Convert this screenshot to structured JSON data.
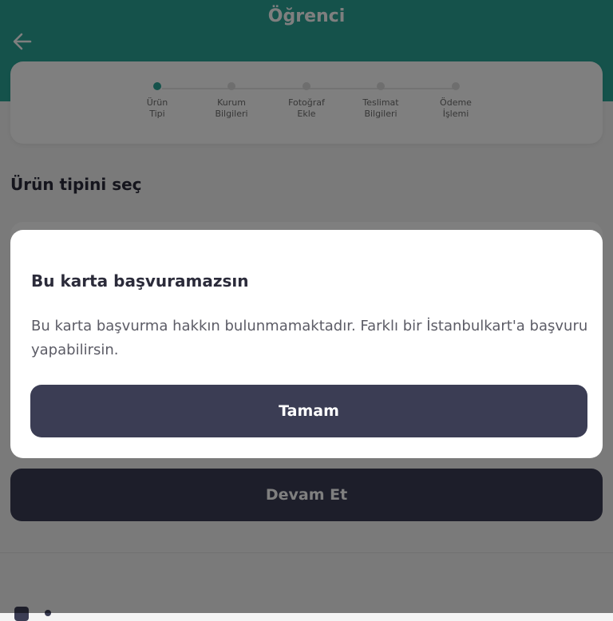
{
  "header": {
    "title": "Öğrenci",
    "back_icon": "arrow-left-icon",
    "color": "#2aa597"
  },
  "stepper": {
    "steps": [
      {
        "label": "Ürün\nTipi",
        "active": true
      },
      {
        "label": "Kurum\nBilgileri",
        "active": false
      },
      {
        "label": "Fotoğraf\nEkle",
        "active": false
      },
      {
        "label": "Teslimat\nBilgileri",
        "active": false
      },
      {
        "label": "Ödeme\nİşlemi",
        "active": false
      }
    ]
  },
  "section": {
    "title": "Ürün tipini seç"
  },
  "continue_button": {
    "label": "Devam Et"
  },
  "modal": {
    "title": "Bu karta başvuramazsın",
    "message": "Bu karta başvurma hakkın bulunmamaktadır. Farklı bir İstanbulkart'a başvuru yapabilirsin.",
    "ok_label": "Tamam"
  },
  "colors": {
    "accent": "#2aa597",
    "button": "#3b3d54"
  }
}
